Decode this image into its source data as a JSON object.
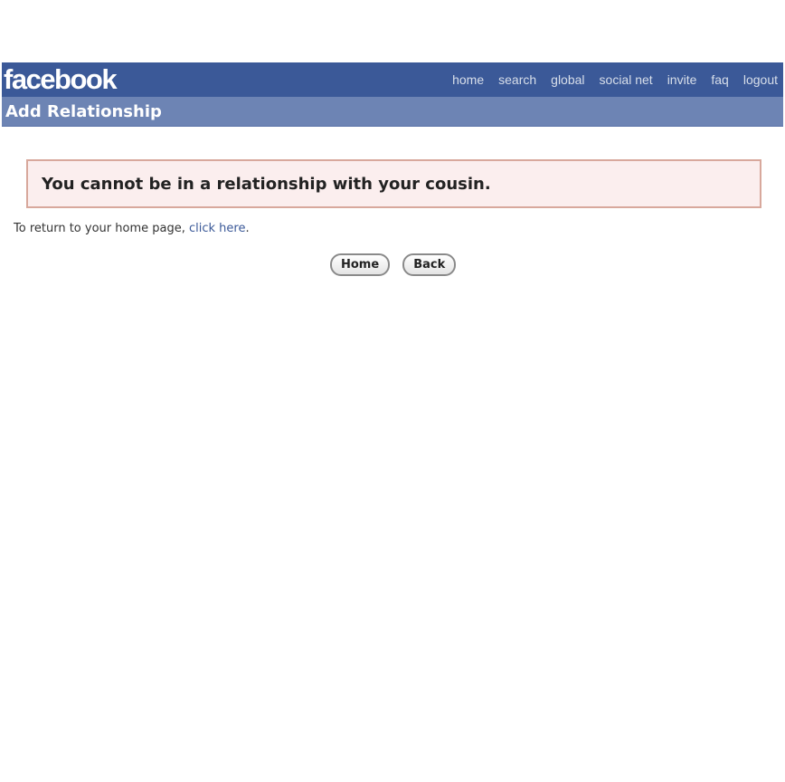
{
  "header": {
    "logo": "facebook",
    "nav": [
      "home",
      "search",
      "global",
      "social net",
      "invite",
      "faq",
      "logout"
    ]
  },
  "subheader": {
    "title": "Add Relationship"
  },
  "error": {
    "message": "You cannot be in a relationship with your cousin."
  },
  "return_line": {
    "prefix": "To return to your home page,",
    "link": "click here",
    "suffix": "."
  },
  "buttons": {
    "home": "Home",
    "back": "Back"
  },
  "colors": {
    "brand_blue": "#3b5998",
    "subbar_blue": "#6d84b4",
    "error_bg": "#fbeeee",
    "error_border": "#d8a89c"
  }
}
